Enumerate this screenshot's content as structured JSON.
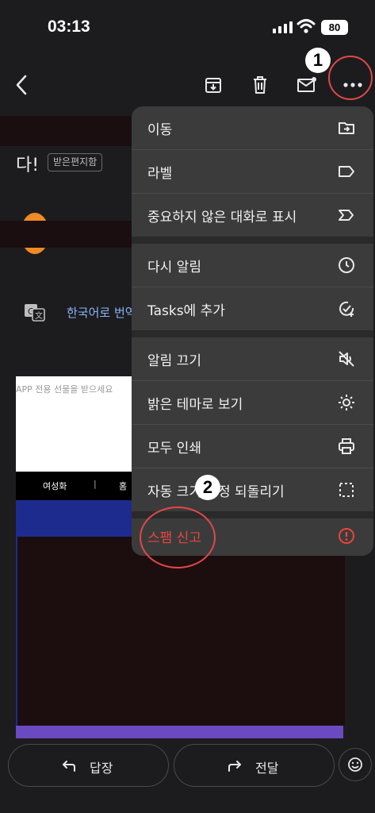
{
  "status_bar": {
    "time": "03:13",
    "battery": "80"
  },
  "annotations": {
    "step1": "1",
    "step2": "2"
  },
  "email": {
    "subject_tail": "다!",
    "folder_badge": "받은편지함",
    "translate_text": "한국어로 번역",
    "promo_text": "APP 전용 선물을 받으세요",
    "nav_1": "여성화",
    "nav_sep": "|",
    "nav_2": "홈"
  },
  "menu": {
    "items": [
      {
        "label": "이동",
        "icon": "move-to-folder-icon"
      },
      {
        "label": "라벨",
        "icon": "label-icon"
      },
      {
        "label": "중요하지 않은 대화로 표시",
        "icon": "mark-not-important-icon"
      },
      {
        "label": "다시 알림",
        "icon": "snooze-clock-icon"
      },
      {
        "label": "Tasks에 추가",
        "icon": "add-task-icon"
      },
      {
        "label": "알림 끄기",
        "icon": "notifications-off-icon"
      },
      {
        "label": "밝은 테마로 보기",
        "icon": "light-theme-icon"
      },
      {
        "label": "모두 인쇄",
        "icon": "print-icon"
      },
      {
        "label": "자동 크기 조정 되돌리기",
        "icon": "revert-autosize-icon"
      },
      {
        "label": "스팸 신고",
        "icon": "report-spam-icon"
      }
    ]
  },
  "colors": {
    "spam": "#e8453c",
    "menu_bg": "#3b3b3c",
    "link": "#8ab4f8"
  },
  "bottom": {
    "reply": "답장",
    "forward": "전달"
  }
}
